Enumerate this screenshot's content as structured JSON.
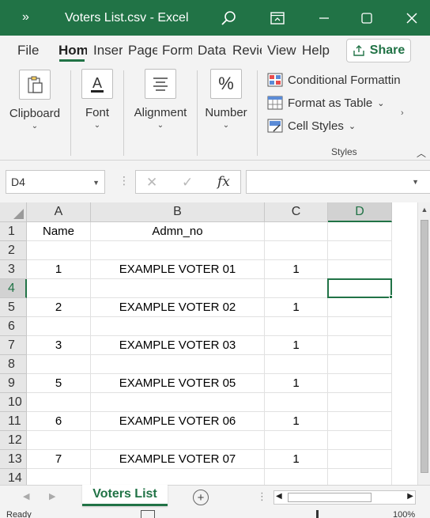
{
  "titlebar": {
    "chevron": "»",
    "title": "Voters List.csv  -  Excel"
  },
  "tabs": [
    {
      "label": "File"
    },
    {
      "label": "Hom"
    },
    {
      "label": "Inser"
    },
    {
      "label": "Page"
    },
    {
      "label": "Form"
    },
    {
      "label": "Data"
    },
    {
      "label": "Revie"
    },
    {
      "label": "View"
    },
    {
      "label": "Help"
    }
  ],
  "share_label": "Share",
  "ribbon": {
    "clipboard": "Clipboard",
    "font": "Font",
    "alignment": "Alignment",
    "number": "Number",
    "number_glyph": "%",
    "conditional_formatting": "Conditional Formattin",
    "format_as_table": "Format as Table",
    "cell_styles": "Cell Styles",
    "styles_group": "Styles",
    "dropdown_caret": "⌄"
  },
  "formula_bar": {
    "name_box": "D4",
    "fx": "fx",
    "formula_value": ""
  },
  "grid": {
    "columns": [
      "A",
      "B",
      "C",
      "D"
    ],
    "selected_column": "D",
    "selected_row": "4",
    "rows": [
      {
        "num": "1",
        "a": "Name",
        "b": "Admn_no",
        "c": ""
      },
      {
        "num": "2",
        "a": "",
        "b": "",
        "c": ""
      },
      {
        "num": "3",
        "a": "1",
        "b": "EXAMPLE VOTER 01",
        "c": "1"
      },
      {
        "num": "4",
        "a": "",
        "b": "",
        "c": ""
      },
      {
        "num": "5",
        "a": "2",
        "b": "EXAMPLE VOTER 02",
        "c": "1"
      },
      {
        "num": "6",
        "a": "",
        "b": "",
        "c": ""
      },
      {
        "num": "7",
        "a": "3",
        "b": "EXAMPLE VOTER 03",
        "c": "1"
      },
      {
        "num": "8",
        "a": "",
        "b": "",
        "c": ""
      },
      {
        "num": "9",
        "a": "5",
        "b": "EXAMPLE VOTER 05",
        "c": "1"
      },
      {
        "num": "10",
        "a": "",
        "b": "",
        "c": ""
      },
      {
        "num": "11",
        "a": "6",
        "b": "EXAMPLE VOTER 06",
        "c": "1"
      },
      {
        "num": "12",
        "a": "",
        "b": "",
        "c": ""
      },
      {
        "num": "13",
        "a": "7",
        "b": "EXAMPLE VOTER 07",
        "c": "1"
      },
      {
        "num": "14",
        "a": "",
        "b": "",
        "c": ""
      }
    ]
  },
  "sheet_tab": "Voters List",
  "add_sheet_glyph": "+",
  "status": {
    "ready": "Ready",
    "zoom": "100%"
  },
  "colors": {
    "accent": "#217346",
    "chrome": "#f3f3f3",
    "header": "#e6e6e6"
  }
}
